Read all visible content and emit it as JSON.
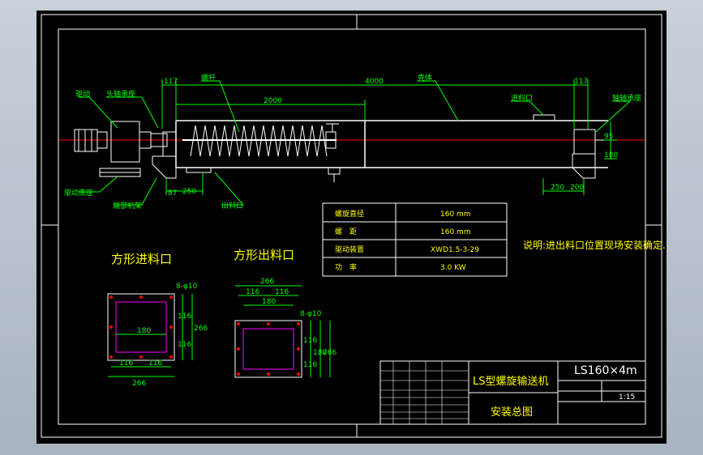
{
  "colors": {
    "background": "#000000",
    "frame": "#ffffff",
    "annotation": "#00ff00",
    "dimension": "#00ff00",
    "centerline": "#ff0000",
    "table_text": "#ffff00"
  },
  "labels": {
    "drive": "驱动",
    "head_bearing": "头轴承座",
    "screw_shaft": "螺杆",
    "casing": "壳体",
    "inlet": "进料口",
    "tail_bearing": "轴轴承座",
    "drive_base": "驱动底座",
    "frame": "端部机架",
    "outlet": "出料口"
  },
  "dims": {
    "d117_left": "117",
    "d2000": "2000",
    "d4000": "4000",
    "d117_right": "117",
    "d87": "87",
    "d250_left": "250",
    "d250_right": "250",
    "d200": "200",
    "d95": "95",
    "d180": "180",
    "in_266_bottom": "266",
    "in_116_a": "116",
    "in_116_b": "116",
    "in_180_h": "180",
    "in_116_r1": "116",
    "in_116_r2": "116",
    "in_266_right": "266",
    "in_hole": "8-φ10",
    "out_266_top": "266",
    "out_116_a": "116",
    "out_116_b": "116",
    "out_180": "180",
    "out_hole": "8-φ10",
    "out_116_r1": "116",
    "out_116_r2": "116",
    "out_180_v": "180",
    "out_266_right": "266"
  },
  "spec_table": {
    "rows": [
      {
        "param": "螺旋直径",
        "value": "160 mm"
      },
      {
        "param": "螺　距",
        "value": "160 mm"
      },
      {
        "param": "驱动装置",
        "value": "XWD1.5-3-29"
      },
      {
        "param": "功　率",
        "value": "3.0 KW"
      }
    ]
  },
  "note": "说明:进出料口位置现场安装确定.",
  "square_inlet_title": "方形进料口",
  "square_outlet_title": "方形出料口",
  "title_block": {
    "model": "LS160×4m",
    "name": "LS型螺旋输送机",
    "drawing_title": "安装总图",
    "scale": "1:15"
  }
}
